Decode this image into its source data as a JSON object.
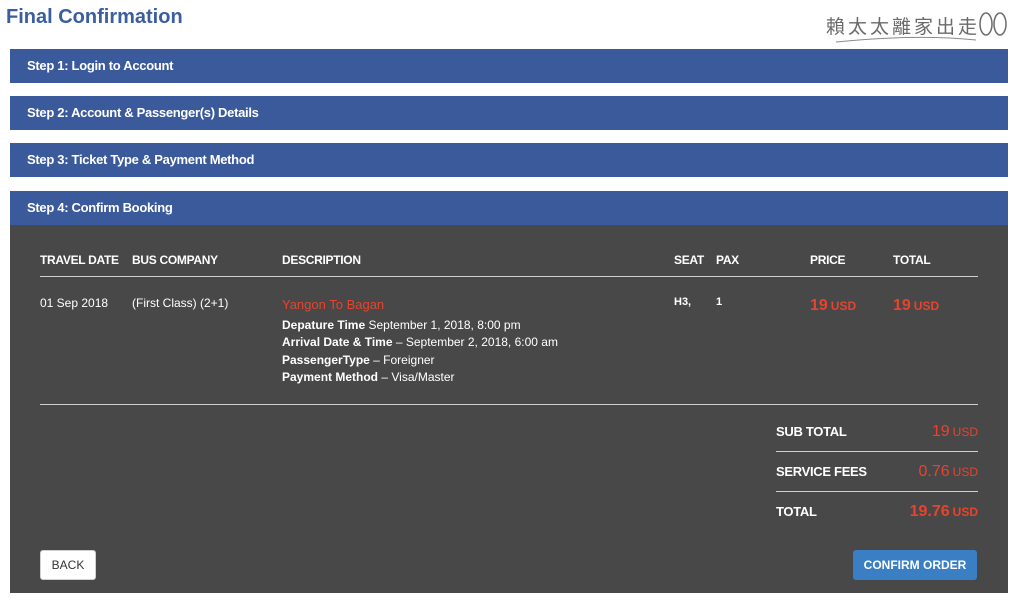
{
  "page": {
    "title": "Final Confirmation"
  },
  "watermark": {
    "text": "賴太太離家出走"
  },
  "steps": [
    {
      "label": "Step 1: Login to Account"
    },
    {
      "label": "Step 2: Account & Passenger(s) Details"
    },
    {
      "label": "Step 3: Ticket Type & Payment Method"
    },
    {
      "label": "Step 4: Confirm Booking"
    }
  ],
  "table": {
    "headers": {
      "travel_date": "TRAVEL DATE",
      "bus_company": "BUS COMPANY",
      "description": "DESCRIPTION",
      "seat": "SEAT",
      "pax": "PAX",
      "price": "PRICE",
      "total": "TOTAL"
    },
    "row": {
      "travel_date": "01 Sep 2018",
      "bus_company": "(First Class) (2+1)",
      "route": "Yangon To Bagan",
      "departure_label": "Depature Time",
      "departure_value": "September 1, 2018, 8:00 pm",
      "arrival_label": "Arrival Date & Time",
      "arrival_value": "– September 2, 2018, 6:00 am",
      "passenger_type_label": "PassengerType",
      "passenger_type_value": "– Foreigner",
      "payment_label": "Payment Method",
      "payment_value": "– Visa/Master",
      "seat": "H3,",
      "pax": "1",
      "price_amount": "19",
      "price_unit": "USD",
      "total_amount": "19",
      "total_unit": "USD"
    }
  },
  "summary": {
    "subtotal_label": "SUB TOTAL",
    "subtotal_amount": "19",
    "subtotal_unit": "USD",
    "fees_label": "SERVICE FEES",
    "fees_amount": "0.76",
    "fees_unit": "USD",
    "total_label": "TOTAL",
    "total_amount": "19.76",
    "total_unit": "USD"
  },
  "buttons": {
    "back": "BACK",
    "confirm": "CONFIRM ORDER"
  },
  "colors": {
    "step_bar": "#3b5a9b",
    "panel": "#484848",
    "accent_red": "#e8432c",
    "confirm_button": "#3a7fc4",
    "title": "#3a5ea0"
  }
}
